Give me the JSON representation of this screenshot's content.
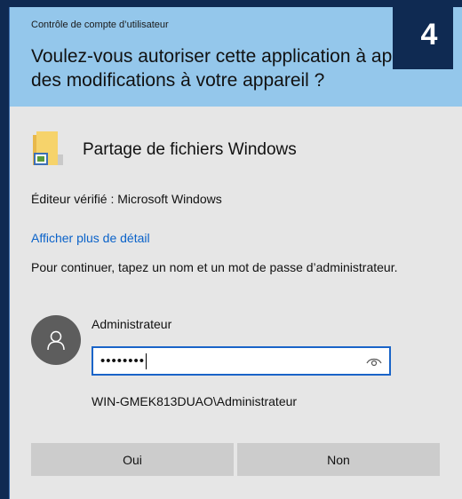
{
  "window": {
    "caption": "Contrôle de compte d’utilisateur",
    "title": "Voulez-vous autoriser cette application à apporter des modifications à votre appareil ?"
  },
  "step_badge": "4",
  "app": {
    "icon": "folder-icon",
    "name": "Partage de fichiers Windows"
  },
  "publisher": "Éditeur vérifié : Microsoft Windows",
  "details_link": "Afficher plus de détail",
  "prompt": "Pour continuer, tapez un nom et un mot de passe d’administrateur.",
  "credentials": {
    "avatar_icon": "user-icon",
    "username": "Administrateur",
    "password_value": "••••••••",
    "reveal_icon": "eye-icon",
    "domain_user": "WIN-GMEK813DUAO\\Administrateur"
  },
  "buttons": {
    "yes": "Oui",
    "no": "Non"
  },
  "colors": {
    "header": "#94c7eb",
    "body": "#e6e6e6",
    "link": "#0a62c9",
    "badge": "#0f2a52"
  }
}
